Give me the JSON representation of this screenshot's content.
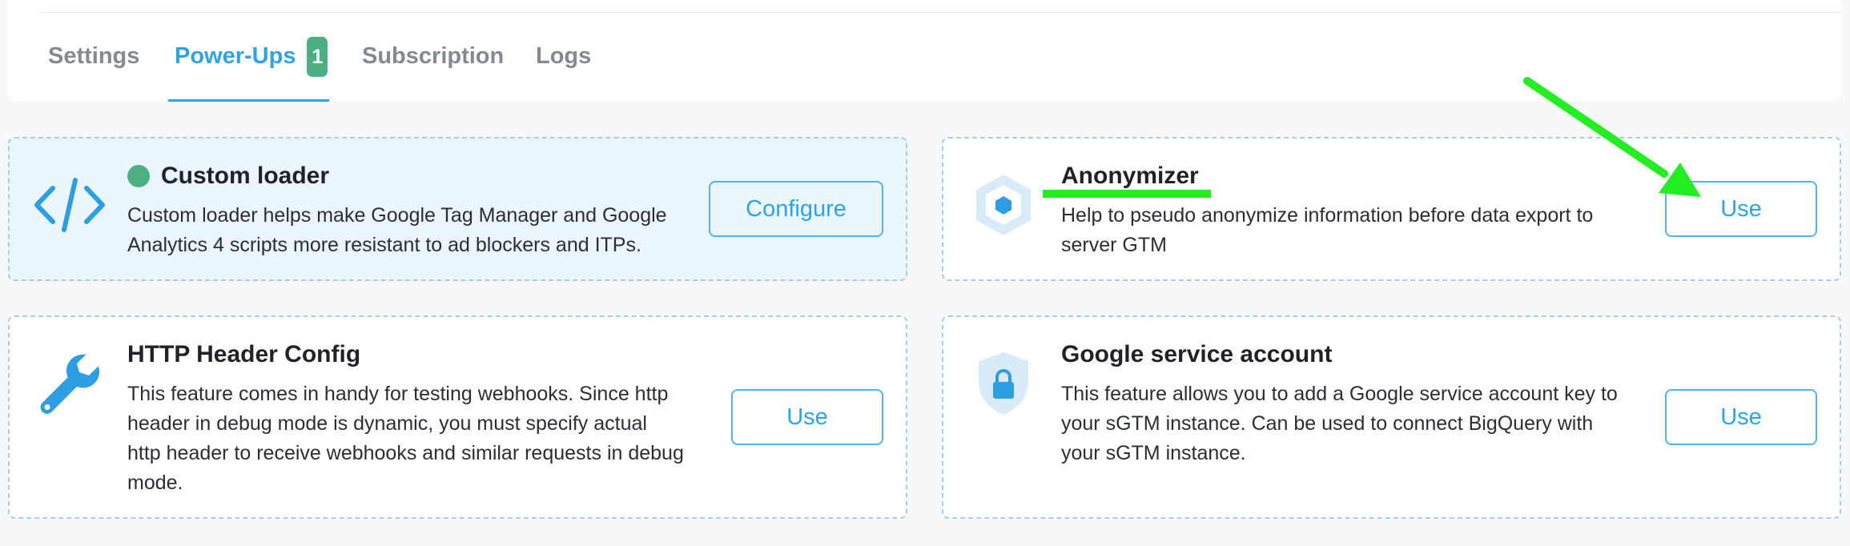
{
  "tabs": [
    {
      "label": "Settings",
      "active": false
    },
    {
      "label": "Power-Ups",
      "active": true,
      "badge": "1"
    },
    {
      "label": "Subscription",
      "active": false
    },
    {
      "label": "Logs",
      "active": false
    }
  ],
  "cards": [
    {
      "title": "Custom loader",
      "description_lines": [
        "Custom loader helps make Google Tag Manager and Google",
        "Analytics 4 scripts more resistant to ad blockers and ITPs."
      ],
      "button_label": "Configure",
      "icon": "code-icon",
      "status": "enabled"
    },
    {
      "title": "Anonymizer",
      "description_lines": [
        "Help to pseudo anonymize information before data export to",
        "server GTM"
      ],
      "button_label": "Use",
      "icon": "hexagon-icon"
    },
    {
      "title": "HTTP Header Config",
      "description_lines": [
        "This feature comes in handy for testing webhooks. Since http",
        "header in debug mode is dynamic, you must specify actual",
        "http header to receive webhooks and similar requests in debug",
        "mode."
      ],
      "button_label": "Use",
      "icon": "wrench-icon"
    },
    {
      "title": "Google service account",
      "description_lines": [
        "This feature allows you to add a Google service account key to",
        "your sGTM instance. Can be used to connect BigQuery with",
        "your sGTM instance."
      ],
      "button_label": "Use",
      "icon": "shield-lock-icon"
    }
  ],
  "colors": {
    "accent": "#2ea3e6",
    "success": "#4caf82",
    "annotation": "#22ee22"
  }
}
